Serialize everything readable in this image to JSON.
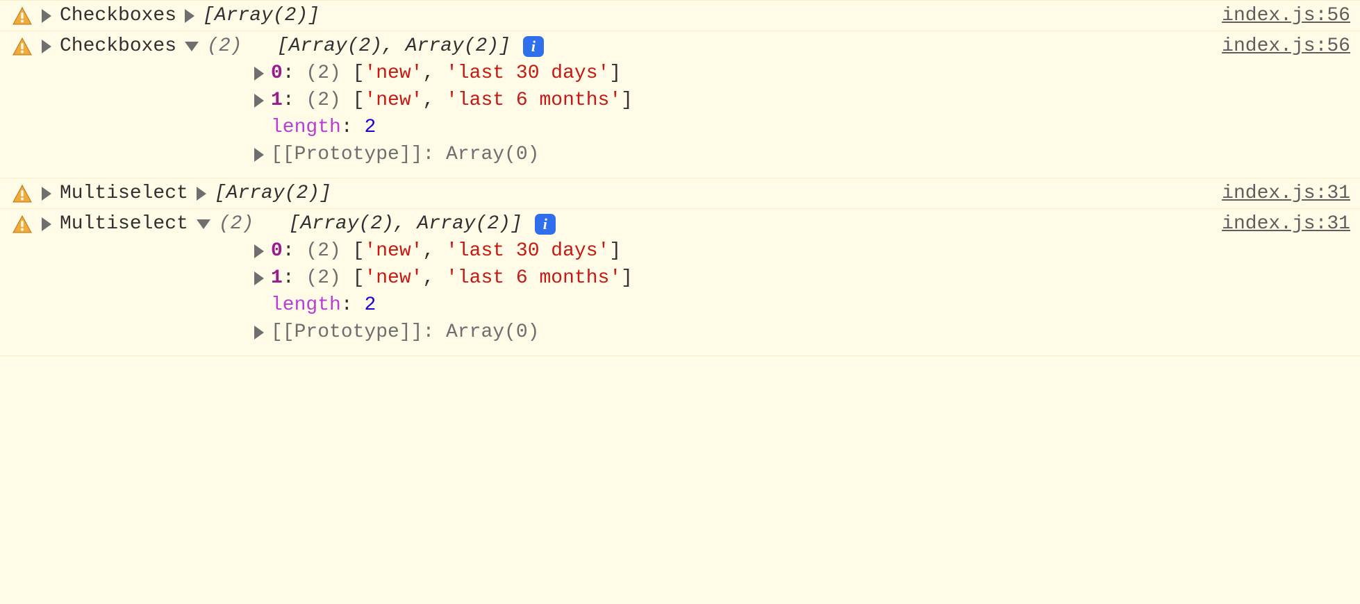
{
  "rows": [
    {
      "label": "Checkboxes",
      "summary": "[Array(2)]",
      "source": "index.js:56",
      "expanded": false
    },
    {
      "label": "Checkboxes",
      "summary_count": "(2)",
      "summary_body": "[Array(2), Array(2)]",
      "info": "i",
      "source": "index.js:56",
      "expanded": true,
      "items": [
        {
          "idx": "0",
          "count": "(2)",
          "vals": [
            "'new'",
            "'last 30 days'"
          ]
        },
        {
          "idx": "1",
          "count": "(2)",
          "vals": [
            "'new'",
            "'last 6 months'"
          ]
        }
      ],
      "length_key": "length",
      "length_val": "2",
      "proto_key": "[[Prototype]]",
      "proto_val": "Array(0)"
    },
    {
      "label": "Multiselect",
      "summary": "[Array(2)]",
      "source": "index.js:31",
      "expanded": false
    },
    {
      "label": "Multiselect",
      "summary_count": "(2)",
      "summary_body": "[Array(2), Array(2)]",
      "info": "i",
      "source": "index.js:31",
      "expanded": true,
      "items": [
        {
          "idx": "0",
          "count": "(2)",
          "vals": [
            "'new'",
            "'last 30 days'"
          ]
        },
        {
          "idx": "1",
          "count": "(2)",
          "vals": [
            "'new'",
            "'last 6 months'"
          ]
        }
      ],
      "length_key": "length",
      "length_val": "2",
      "proto_key": "[[Prototype]]",
      "proto_val": "Array(0)"
    }
  ]
}
